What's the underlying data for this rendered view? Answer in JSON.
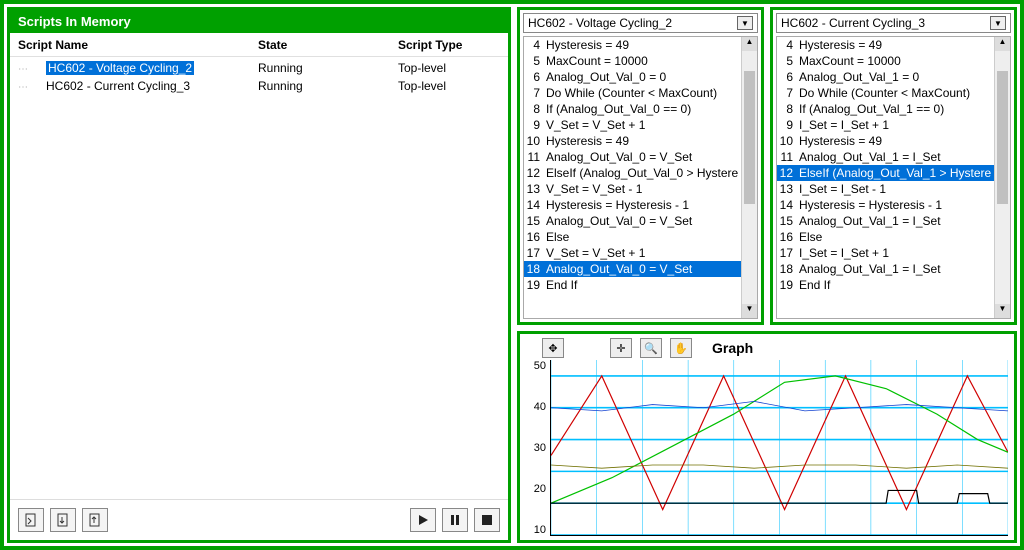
{
  "left": {
    "header": "Scripts In Memory",
    "columns": {
      "name": "Script Name",
      "state": "State",
      "type": "Script Type"
    },
    "rows": [
      {
        "name": "HC602 - Voltage Cycling_2",
        "state": "Running",
        "type": "Top-level",
        "selected": true
      },
      {
        "name": "HC602 - Current Cycling_3",
        "state": "Running",
        "type": "Top-level",
        "selected": false
      }
    ],
    "buttons_left": [
      "doc-new",
      "doc-import",
      "doc-export"
    ],
    "buttons_right": [
      "play",
      "pause",
      "stop"
    ]
  },
  "scriptA": {
    "title": "HC602 - Voltage Cycling_2",
    "highlight": 18,
    "lines": [
      {
        "n": 4,
        "t": "Hysteresis = 49"
      },
      {
        "n": 5,
        "t": "MaxCount = 10000"
      },
      {
        "n": 6,
        "t": "Analog_Out_Val_0 = 0"
      },
      {
        "n": 7,
        "t": "Do While (Counter < MaxCount)"
      },
      {
        "n": 8,
        "t": " If (Analog_Out_Val_0 == 0)"
      },
      {
        "n": 9,
        "t": "  V_Set = V_Set + 1"
      },
      {
        "n": 10,
        "t": "  Hysteresis = 49"
      },
      {
        "n": 11,
        "t": "  Analog_Out_Val_0 = V_Set"
      },
      {
        "n": 12,
        "t": " ElseIf (Analog_Out_Val_0 > Hystere"
      },
      {
        "n": 13,
        "t": "  V_Set = V_Set - 1"
      },
      {
        "n": 14,
        "t": "  Hysteresis = Hysteresis - 1"
      },
      {
        "n": 15,
        "t": "  Analog_Out_Val_0 = V_Set"
      },
      {
        "n": 16,
        "t": " Else"
      },
      {
        "n": 17,
        "t": "  V_Set = V_Set + 1"
      },
      {
        "n": 18,
        "t": "  Analog_Out_Val_0 = V_Set"
      },
      {
        "n": 19,
        "t": " End If"
      }
    ]
  },
  "scriptB": {
    "title": "HC602 - Current Cycling_3",
    "highlight": 12,
    "lines": [
      {
        "n": 4,
        "t": "Hysteresis = 49"
      },
      {
        "n": 5,
        "t": "MaxCount = 10000"
      },
      {
        "n": 6,
        "t": "Analog_Out_Val_1 = 0"
      },
      {
        "n": 7,
        "t": "Do While (Counter < MaxCount)"
      },
      {
        "n": 8,
        "t": " If (Analog_Out_Val_1 == 0)"
      },
      {
        "n": 9,
        "t": "  I_Set = I_Set + 1"
      },
      {
        "n": 10,
        "t": "  Hysteresis = 49"
      },
      {
        "n": 11,
        "t": "  Analog_Out_Val_1 = I_Set"
      },
      {
        "n": 12,
        "t": " ElseIf (Analog_Out_Val_1 > Hystere"
      },
      {
        "n": 13,
        "t": "  I_Set = I_Set - 1"
      },
      {
        "n": 14,
        "t": "  Hysteresis = Hysteresis - 1"
      },
      {
        "n": 15,
        "t": "  Analog_Out_Val_1 = I_Set"
      },
      {
        "n": 16,
        "t": " Else"
      },
      {
        "n": 17,
        "t": "  I_Set = I_Set + 1"
      },
      {
        "n": 18,
        "t": "  Analog_Out_Val_1 = I_Set"
      },
      {
        "n": 19,
        "t": " End If"
      }
    ]
  },
  "graph": {
    "title": "Graph",
    "yticks": [
      "50",
      "40",
      "30",
      "20",
      "10"
    ],
    "tools": [
      "settings",
      "crosshair",
      "zoom",
      "hand"
    ]
  },
  "chart_data": {
    "type": "line",
    "title": "Graph",
    "ylim": [
      0,
      55
    ],
    "xrange": [
      0,
      450
    ],
    "series": [
      {
        "name": "red-triangle",
        "color": "#d00000",
        "points": [
          [
            0,
            25
          ],
          [
            50,
            50
          ],
          [
            110,
            8
          ],
          [
            170,
            50
          ],
          [
            230,
            8
          ],
          [
            290,
            50
          ],
          [
            350,
            8
          ],
          [
            410,
            50
          ],
          [
            450,
            26
          ]
        ]
      },
      {
        "name": "green-stepped",
        "color": "#00c000",
        "points": [
          [
            0,
            10
          ],
          [
            60,
            18
          ],
          [
            120,
            28
          ],
          [
            180,
            38
          ],
          [
            230,
            48
          ],
          [
            280,
            50
          ],
          [
            330,
            46
          ],
          [
            380,
            38
          ],
          [
            420,
            30
          ],
          [
            450,
            26
          ]
        ]
      },
      {
        "name": "blue-noisy",
        "color": "#1040d0",
        "points": [
          [
            0,
            40
          ],
          [
            50,
            39
          ],
          [
            100,
            41
          ],
          [
            150,
            40
          ],
          [
            200,
            42
          ],
          [
            250,
            39
          ],
          [
            300,
            40
          ],
          [
            350,
            41
          ],
          [
            400,
            40
          ],
          [
            450,
            39
          ]
        ]
      },
      {
        "name": "olive-noisy",
        "color": "#707000",
        "points": [
          [
            0,
            22
          ],
          [
            50,
            21
          ],
          [
            100,
            22
          ],
          [
            150,
            22
          ],
          [
            200,
            21
          ],
          [
            250,
            22
          ],
          [
            300,
            22
          ],
          [
            350,
            21
          ],
          [
            400,
            22
          ],
          [
            450,
            21
          ]
        ]
      },
      {
        "name": "black-step",
        "color": "#000000",
        "points": [
          [
            0,
            10
          ],
          [
            330,
            10
          ],
          [
            332,
            14
          ],
          [
            360,
            14
          ],
          [
            362,
            10
          ],
          [
            400,
            10
          ],
          [
            402,
            13
          ],
          [
            430,
            13
          ],
          [
            432,
            10
          ],
          [
            450,
            10
          ]
        ]
      }
    ]
  }
}
